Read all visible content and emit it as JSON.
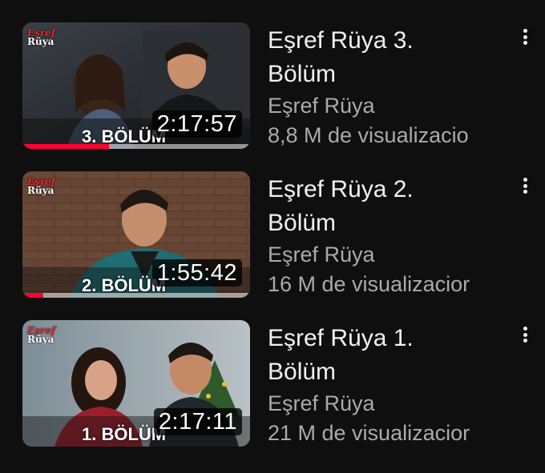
{
  "videos": [
    {
      "title": "Eşref Rüya 3.\nBölüm",
      "channel": "Eşref Rüya",
      "views": "8,8 M de visualizacio",
      "duration": "2:17:57",
      "thumbnail_label": "3. BÖLÜM",
      "logo_line1": "Eşref",
      "logo_line2": "Rüya",
      "watched_fraction": 0.38
    },
    {
      "title": "Eşref Rüya 2.\nBölüm",
      "channel": "Eşref Rüya",
      "views": "16 M de visualizacior",
      "duration": "1:55:42",
      "thumbnail_label": "2. BÖLÜM",
      "logo_line1": "Eşref",
      "logo_line2": "Rüya",
      "watched_fraction": 0.09
    },
    {
      "title": "Eşref Rüya 1.\nBölüm",
      "channel": "Eşref Rüya",
      "views": "21 M de visualizacior",
      "duration": "2:17:11",
      "thumbnail_label": "1. BÖLÜM",
      "logo_line1": "Eşref",
      "logo_line2": "Rüya",
      "watched_fraction": 0.0
    }
  ],
  "icons": {
    "more": "more-vert-icon"
  },
  "colors": {
    "background": "#0f0f0f",
    "title": "#f1f1f1",
    "secondary_text": "#aaaaaa",
    "progress_red": "#ff0033"
  }
}
